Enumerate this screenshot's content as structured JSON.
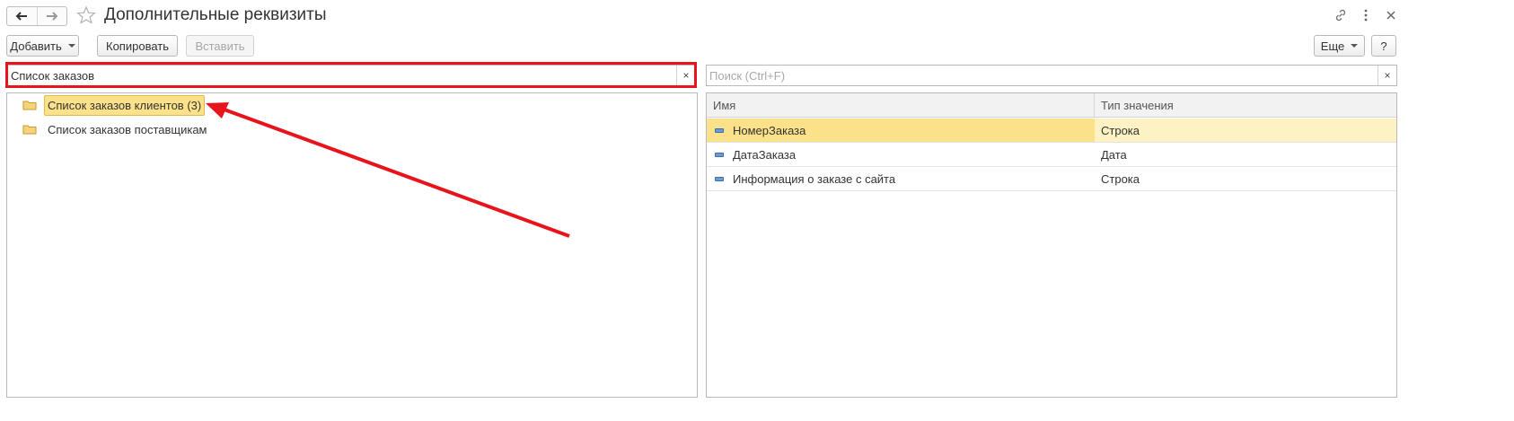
{
  "window": {
    "title": "Дополнительные реквизиты"
  },
  "toolbar": {
    "add_label": "Добавить",
    "copy_label": "Копировать",
    "paste_label": "Вставить",
    "more_label": "Еще",
    "help_label": "?"
  },
  "left_search": {
    "value": "Список заказов",
    "clear": "×"
  },
  "right_search": {
    "placeholder": "Поиск (Ctrl+F)",
    "clear": "×"
  },
  "tree": {
    "items": [
      {
        "label": "Список заказов клиентов (3)",
        "selected": true
      },
      {
        "label": "Список заказов поставщикам",
        "selected": false
      }
    ]
  },
  "grid": {
    "columns": [
      "Имя",
      "Тип значения"
    ],
    "rows": [
      {
        "name": "НомерЗаказа",
        "type": "Строка",
        "selected": true
      },
      {
        "name": "ДатаЗаказа",
        "type": "Дата",
        "selected": false
      },
      {
        "name": "Информация о заказе с сайта",
        "type": "Строка",
        "selected": false
      }
    ]
  },
  "colors": {
    "annotation_red": "#e8141b",
    "selection_yellow": "#fbe28a",
    "folder_yellow": "#f2c14e"
  },
  "icons": [
    "back-arrow-icon",
    "forward-arrow-icon",
    "star-icon",
    "link-icon",
    "more-vertical-icon",
    "close-icon",
    "folder-icon",
    "attribute-icon"
  ]
}
